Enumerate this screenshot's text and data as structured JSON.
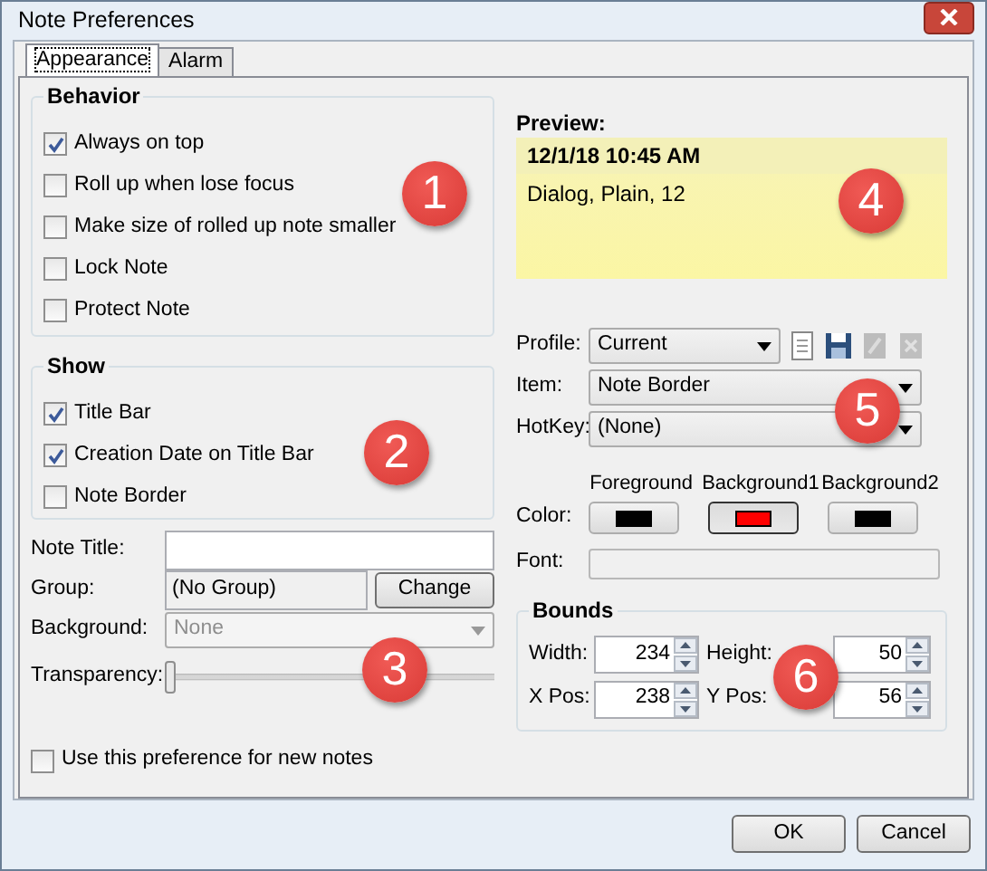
{
  "window": {
    "title": "Note Preferences"
  },
  "tabs": [
    {
      "label": "Appearance",
      "selected": true
    },
    {
      "label": "Alarm",
      "selected": false
    }
  ],
  "behavior": {
    "title": "Behavior",
    "options": [
      {
        "label": "Always on top",
        "checked": true
      },
      {
        "label": "Roll up when lose focus",
        "checked": false
      },
      {
        "label": "Make size of rolled up note smaller",
        "checked": false
      },
      {
        "label": "Lock Note",
        "checked": false
      },
      {
        "label": "Protect Note",
        "checked": false
      }
    ]
  },
  "show": {
    "title": "Show",
    "options": [
      {
        "label": "Title Bar",
        "checked": true
      },
      {
        "label": "Creation Date on Title Bar",
        "checked": true
      },
      {
        "label": "Note Border",
        "checked": false
      }
    ]
  },
  "note_title": {
    "label": "Note Title:"
  },
  "group": {
    "label": "Group:",
    "value": "(No Group)",
    "button": "Change"
  },
  "background": {
    "label": "Background:",
    "value": "None",
    "disabled": true
  },
  "transparency": {
    "label": "Transparency:",
    "level": 0
  },
  "use_for_new": {
    "label": "Use this preference for new notes",
    "checked": false
  },
  "preview": {
    "label": "Preview:",
    "title": "12/1/18 10:45 AM",
    "text": "Dialog, Plain, 12"
  },
  "profile": {
    "label": "Profile:",
    "value": "Current",
    "tools": [
      {
        "kind": "new",
        "disabled": false
      },
      {
        "kind": "save",
        "disabled": false
      },
      {
        "kind": "edit",
        "disabled": true
      },
      {
        "kind": "delete",
        "disabled": true
      }
    ]
  },
  "item": {
    "label": "Item:",
    "value": "Note Border"
  },
  "hotkey": {
    "label": "HotKey:",
    "value": "(None)"
  },
  "colors": {
    "label": "Color:",
    "swatches": [
      {
        "label": "Foreground",
        "color": "#000000",
        "selected": false
      },
      {
        "label": "Background1",
        "color": "#ff0000",
        "selected": true
      },
      {
        "label": "Background2",
        "color": "#000000",
        "selected": false
      }
    ]
  },
  "font": {
    "label": "Font:"
  },
  "bounds": {
    "title": "Bounds",
    "fields": [
      {
        "label": "Width:",
        "value": "234"
      },
      {
        "label": "Height:",
        "value": "50"
      },
      {
        "label": "X Pos:",
        "value": "238"
      },
      {
        "label": "Y Pos:",
        "value": "56"
      }
    ]
  },
  "buttons": [
    "OK",
    "Cancel"
  ],
  "callouts": [
    "1",
    "2",
    "3",
    "4",
    "5",
    "6"
  ]
}
